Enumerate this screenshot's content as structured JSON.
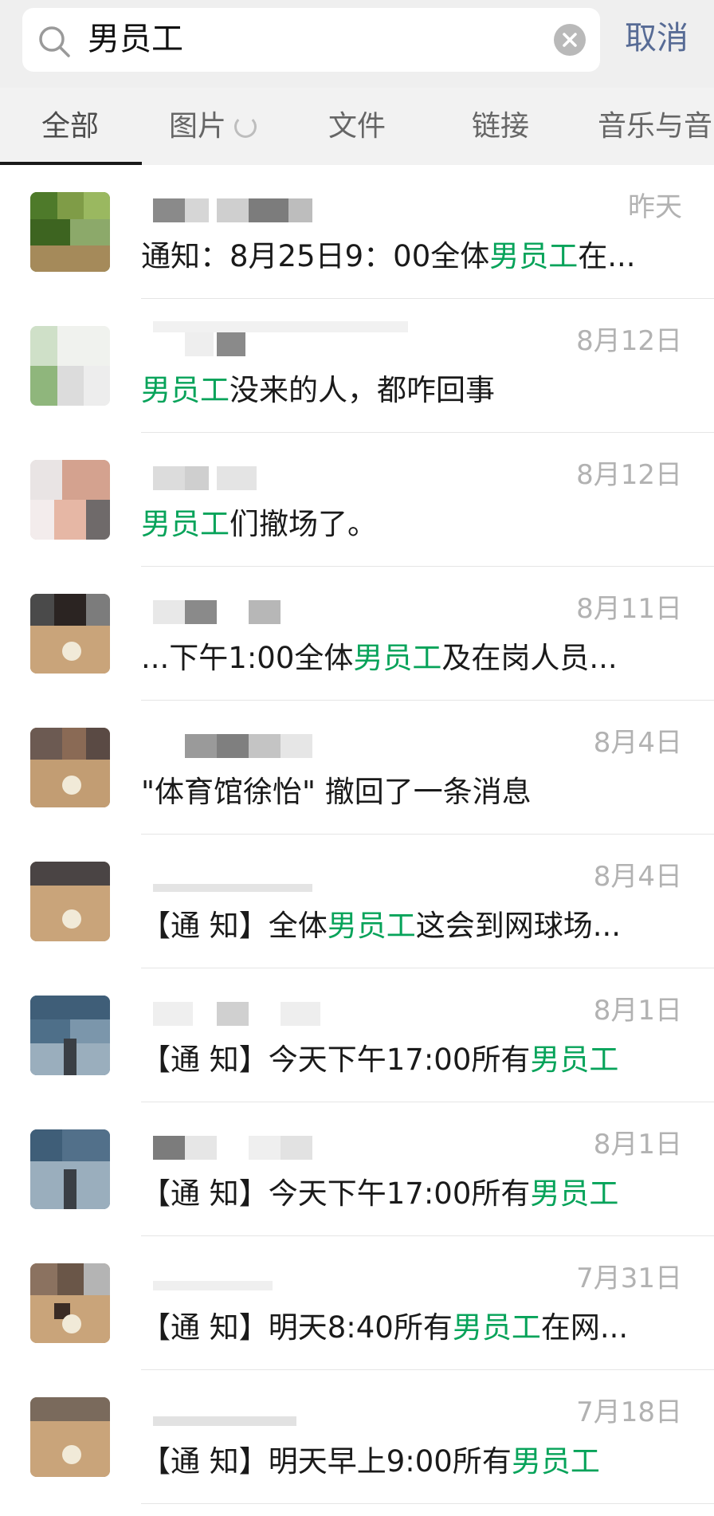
{
  "search": {
    "query": "男员工",
    "cancel_label": "取消"
  },
  "tabs": [
    {
      "label": "全部"
    },
    {
      "label": "图片"
    },
    {
      "label": "文件"
    },
    {
      "label": "链接"
    },
    {
      "label": "音乐与音"
    }
  ],
  "results": [
    {
      "date": "昨天",
      "before": "通知：8月25日9：00全体",
      "highlight": "男员工",
      "after": "在..."
    },
    {
      "date": "8月12日",
      "before": "",
      "highlight": "男员工",
      "after": "没来的人，都咋回事"
    },
    {
      "date": "8月12日",
      "before": "",
      "highlight": "男员工",
      "after": "们撤场了。"
    },
    {
      "date": "8月11日",
      "before": "...下午1:00全体",
      "highlight": "男员工",
      "after": "及在岗人员..."
    },
    {
      "date": "8月4日",
      "before": "\"体育馆徐怡\" 撤回了一条消息",
      "highlight": "",
      "after": ""
    },
    {
      "date": "8月4日",
      "before": "【通 知】全体",
      "highlight": "男员工",
      "after": "这会到网球场..."
    },
    {
      "date": "8月1日",
      "before": "【通 知】今天下午17:00所有",
      "highlight": "男员工",
      "after": ""
    },
    {
      "date": "8月1日",
      "before": "【通 知】今天下午17:00所有",
      "highlight": "男员工",
      "after": ""
    },
    {
      "date": "7月31日",
      "before": "【通 知】明天8:40所有",
      "highlight": "男员工",
      "after": "在网..."
    },
    {
      "date": "7月18日",
      "before": "【通 知】明天早上9:00所有",
      "highlight": "男员工",
      "after": ""
    }
  ],
  "colors": {
    "highlight": "#07a35a",
    "cancel": "#576b95",
    "date": "#b2b2b2"
  },
  "icons": {
    "search": "magnifier-icon",
    "clear": "clear-x-icon",
    "loading": "spinner-icon"
  }
}
